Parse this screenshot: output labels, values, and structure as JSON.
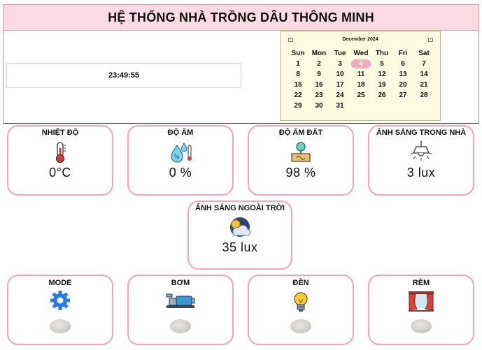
{
  "header": {
    "title": "HỆ THỐNG NHÀ TRỒNG DÂU THÔNG MINH"
  },
  "clock": {
    "time": "23:49:55"
  },
  "calendar": {
    "month_label": "December 2024",
    "weekdays": [
      "Sun",
      "Mon",
      "Tue",
      "Wed",
      "Thu",
      "Fri",
      "Sat"
    ],
    "weeks": [
      [
        "1",
        "2",
        "3",
        "4",
        "5",
        "6",
        "7"
      ],
      [
        "8",
        "9",
        "10",
        "11",
        "12",
        "13",
        "14"
      ],
      [
        "15",
        "16",
        "17",
        "18",
        "19",
        "20",
        "21"
      ],
      [
        "22",
        "23",
        "24",
        "25",
        "26",
        "27",
        "28"
      ],
      [
        "29",
        "30",
        "31",
        "",
        "",
        "",
        ""
      ]
    ],
    "selected": "4"
  },
  "sensors": {
    "temp": {
      "label": "NHIỆT ĐỘ",
      "value": "0°C",
      "icon": "thermometer-icon"
    },
    "humidity": {
      "label": "ĐỘ ẨM",
      "value": "0 %",
      "icon": "humidity-icon"
    },
    "soil": {
      "label": "ĐỘ ẨM ĐẤT",
      "value": "98 %",
      "icon": "soil-moisture-icon"
    },
    "light_in": {
      "label": "ÁNH SÁNG TRONG NHÀ",
      "value": "3 lux",
      "icon": "ceiling-lamp-icon"
    },
    "light_out": {
      "label": "ÁNH SÁNG NGOÀI TRỜI",
      "value": "35 lux",
      "icon": "sun-cloud-icon"
    }
  },
  "controls": {
    "mode": {
      "label": "MODE",
      "icon": "gear-icon"
    },
    "pump": {
      "label": "BƠM",
      "icon": "pump-icon"
    },
    "lamp": {
      "label": "ĐÈN",
      "icon": "light-bulb-icon"
    },
    "curtain": {
      "label": "RÈM",
      "icon": "curtain-icon"
    }
  },
  "colors": {
    "header_bg": "#fbdbe3",
    "card_border": "#f0a5b8",
    "calendar_bg": "#fdfbe2",
    "today": "#f2a9bd"
  }
}
